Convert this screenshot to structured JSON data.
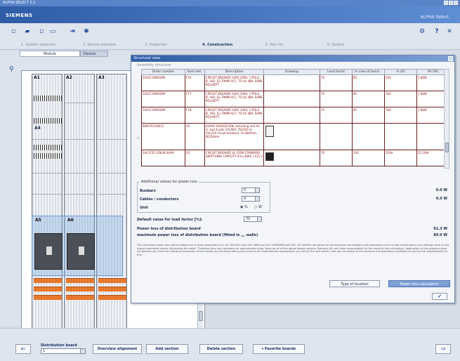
{
  "window": {
    "title": "ALPHA SELECT 5.2"
  },
  "banner": {
    "brand": "SIEMENS",
    "product": "ALPHA Select"
  },
  "steps": [
    {
      "label": "1. System selection",
      "active": false
    },
    {
      "label": "2. Device selection",
      "active": false
    },
    {
      "label": "3. Properties",
      "active": false
    },
    {
      "label": "4. Construction",
      "active": true
    },
    {
      "label": "5. Part list",
      "active": false
    },
    {
      "label": "6. Output",
      "active": false
    }
  ],
  "left": {
    "tab_active": "Module",
    "tab_other": "Device"
  },
  "racks": [
    {
      "label": "A1"
    },
    {
      "label": "A2"
    },
    {
      "label": "A3"
    },
    {
      "label": "A4"
    },
    {
      "label": "A5"
    },
    {
      "label": "A6"
    }
  ],
  "dialog": {
    "title": "Structural view",
    "section": "Assembly structure",
    "columns": [
      "Order number",
      "Item des.",
      "Description",
      "Drawing",
      "Load factor",
      "In case of band...",
      "In [A]",
      "PV [W]"
    ],
    "rows": [
      {
        "order": "5SX21166RGM0",
        "item": "F16",
        "desc": "CIRCUIT BREAKER 240V 10KA, 1-POLE, B, 16A, D=70MM ACC. TO UL 489, SAME POLARITY",
        "drawing": "",
        "load": "70",
        "band": "85",
        "in": "16A",
        "pv": "1.86W"
      },
      {
        "order": "5SX21166RGM0",
        "item": "F17",
        "desc": "CIRCUIT BREAKER 240V 10KA, 1-POLE, B, 16A, D=70MM ACC. TO UL 489, SAME POLARITY",
        "drawing": "",
        "load": "70",
        "band": "85",
        "in": "16A",
        "pv": "1.86W"
      },
      {
        "order": "5SX21166RGM0",
        "item": "F18",
        "desc": "CIRCUIT BREAKER 240V 10KA, 1-POLE, B, 16A, D=70MM ACC. TO UL 489, SAME POLARITY",
        "drawing": "",
        "load": "70",
        "band": "85",
        "in": "16A",
        "pv": "1.86W"
      },
      {
        "order": "8WH7013DE12",
        "item": "A5",
        "desc": "ALPHA 400/630 DIN, mounting unit for 3- and 4-pole 3VL400, 3VL630 or 3VL250 circuit breakers, H=800mm, W250mm",
        "drawing": "img",
        "load": "",
        "band": "",
        "in": "",
        "pv": ""
      },
      {
        "order": "3VL3725-1DK36-0AA0",
        "item": "Q1",
        "desc": "CIRCUIT BREAKER VL 250N STANDARD SWITCHING CAPACITY ICU=40KA / 415 V",
        "drawing": "img-dark",
        "load": "70",
        "band": "100",
        "in": "250A",
        "pv": "25.16W"
      }
    ],
    "addvals_legend": "Additional values for power loss",
    "busbars_label": "Busbars",
    "busbars_value": "0",
    "busbars_power": "0.0 W",
    "cables_label": "Cables / conductors",
    "cables_value": "0",
    "cables_power": "0.0 W",
    "unit_label": "Unit",
    "unit_opt1": "%",
    "unit_opt2": "W",
    "default_load_label": "Default value for load factor [%]:",
    "default_load_value": "70",
    "power_loss_label": "Power loss of distribution board",
    "power_loss_value": "61.3 W",
    "max_power_loss_label": "maximum power loss of distribution board (fitted in ,,, walls)",
    "max_power_loss_value": "80.0 W",
    "note": "The calculated power loss values stated and in these dependence on IEC 60439/1 and VDE 0660 part 507 (VDE0660 part 507, IEC 60890) are based on the standard assumptions and parameters and include combinations and settings done by the above-mentioned values influencing the result. Therefore they only represent an approximate value. Because of all the above stated reasons, Siemens AG can't take responsibility for the result of this calculation. Application of this program does not absolve you from the individual inspection of the results you achieved taking into account the implemented assumptions you will be the sole bearer, that you are aware of the standard and operating conditions as well as the responsibility for this.",
    "btn_type": "Type of location",
    "btn_calc": "Power loss calculation",
    "btn_ok": "✔"
  },
  "bottom": {
    "dist_label": "Distribution board",
    "dist_value": "1",
    "btn_overview": "Overview alignment",
    "btn_add": "Add section",
    "btn_delete": "Delete section",
    "btn_fav": "Favorite boards",
    "prev": "⇐",
    "next": "⇒"
  }
}
